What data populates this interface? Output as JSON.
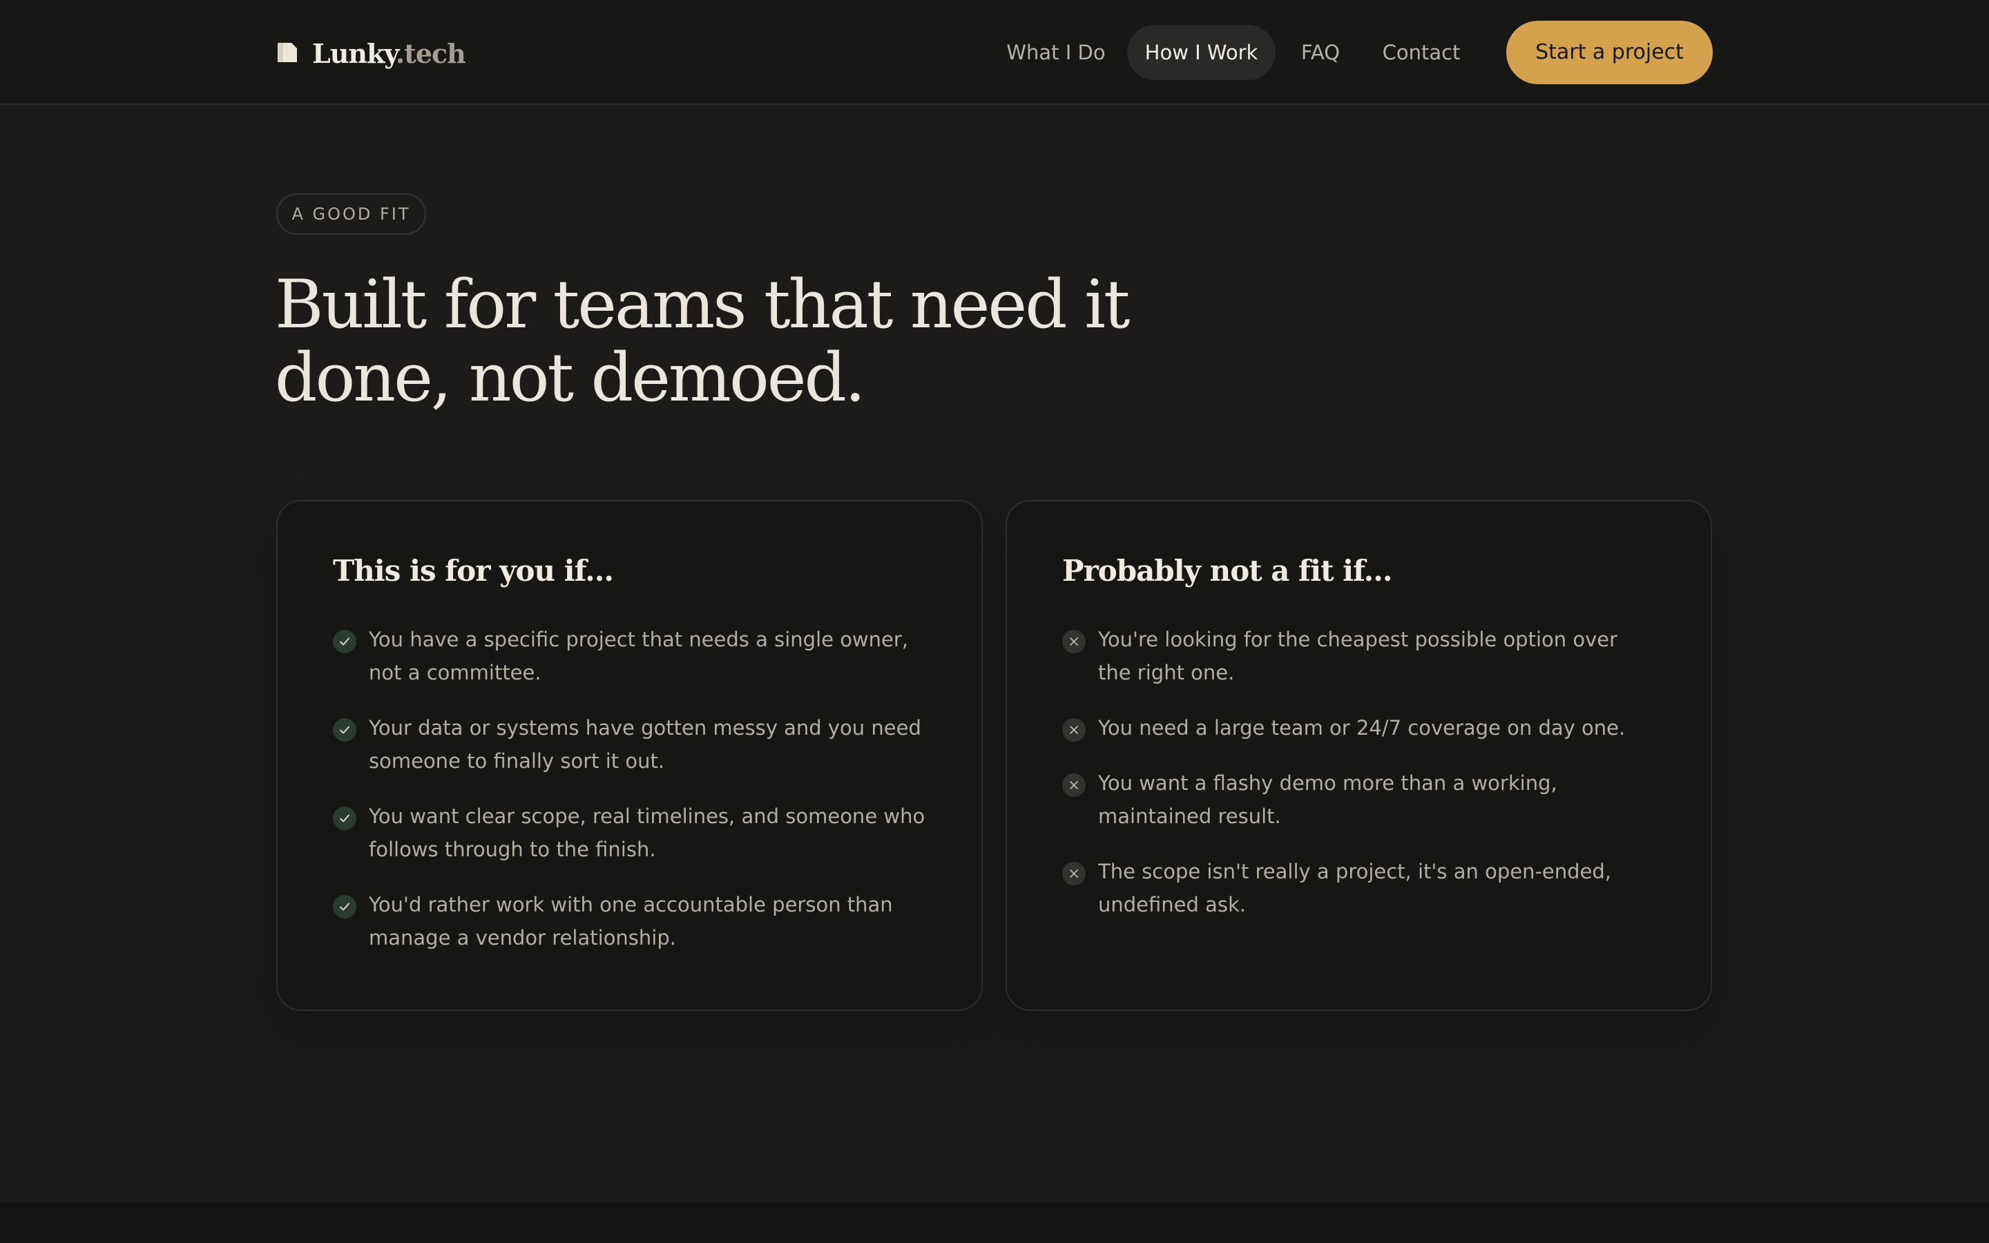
{
  "header": {
    "logo": {
      "name": "Lunky",
      "tld": ".tech"
    },
    "nav": [
      {
        "label": "What I Do"
      },
      {
        "label": "How I Work",
        "active": true
      },
      {
        "label": "FAQ"
      },
      {
        "label": "Contact"
      }
    ],
    "cta_label": "Start a project"
  },
  "hero": {
    "badge": "A GOOD FIT",
    "headline_line1": "Built for teams that need it",
    "headline_line2": "done, not demoed."
  },
  "fit_card": {
    "title": "This is for you if...",
    "icon": "check-icon",
    "items": [
      "You have a specific project that needs a single owner, not a committee.",
      "Your data or systems have gotten messy and you need someone to finally sort it out.",
      "You want clear scope, real timelines, and someone who follows through to the finish.",
      "You'd rather work with one accountable person than manage a vendor relationship."
    ]
  },
  "not_fit_card": {
    "title": "Probably not a fit if...",
    "icon": "x-icon",
    "items": [
      "You're looking for the cheapest possible option over the right one.",
      "You need a large team or 24/7 coverage on day one.",
      "You want a flashy demo more than a working, maintained result.",
      "The scope isn't really a project, it's an open-ended, undefined ask."
    ]
  },
  "colors": {
    "background": "#1c1b19",
    "header": "#171716",
    "accent": "#d4a24c",
    "text_primary": "#ede8df",
    "text_muted": "#b3ada3"
  }
}
